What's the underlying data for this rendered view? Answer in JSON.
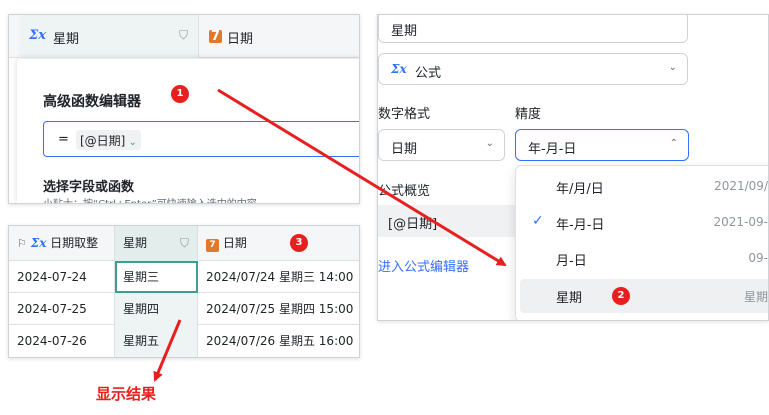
{
  "editor": {
    "column1": "星期",
    "column2": "日期",
    "title": "高级函数编辑器",
    "formula_eq": "=",
    "formula_tag": "[@日期]",
    "section_title": "选择字段或函数",
    "tip": "小贴士：按“Ctrl+Enter”可快速输入选中的内容",
    "badge": "1"
  },
  "table": {
    "headers": [
      "日期取整",
      "星期",
      "日期"
    ],
    "rows": [
      [
        "2024-07-24",
        "星期三",
        "2024/07/24 星期三 14:00"
      ],
      [
        "2024-07-25",
        "星期四",
        "2024/07/25 星期四 15:00"
      ],
      [
        "2024-07-26",
        "星期五",
        "2024/07/26 星期五 16:00"
      ]
    ],
    "badge": "3"
  },
  "settings": {
    "name_value": "星期",
    "type_label": "公式",
    "number_format_label": "数字格式",
    "number_format_value": "日期",
    "precision_label": "精度",
    "precision_value": "年-月-日",
    "overview_label": "公式概览",
    "overview_value": "[@日期]",
    "editor_link": "进入公式编辑器",
    "options": [
      {
        "label": "年/月/日",
        "example": "2021/09/"
      },
      {
        "label": "年-月-日",
        "example": "2021-09-"
      },
      {
        "label": "月-日",
        "example": "09-"
      },
      {
        "label": "星期",
        "example": "星期"
      }
    ],
    "badge": "2"
  },
  "result_label": "显示结果",
  "colors": {
    "accent": "#3370ff",
    "annotation": "#e81f1f",
    "selection": "#3c9e8e"
  }
}
